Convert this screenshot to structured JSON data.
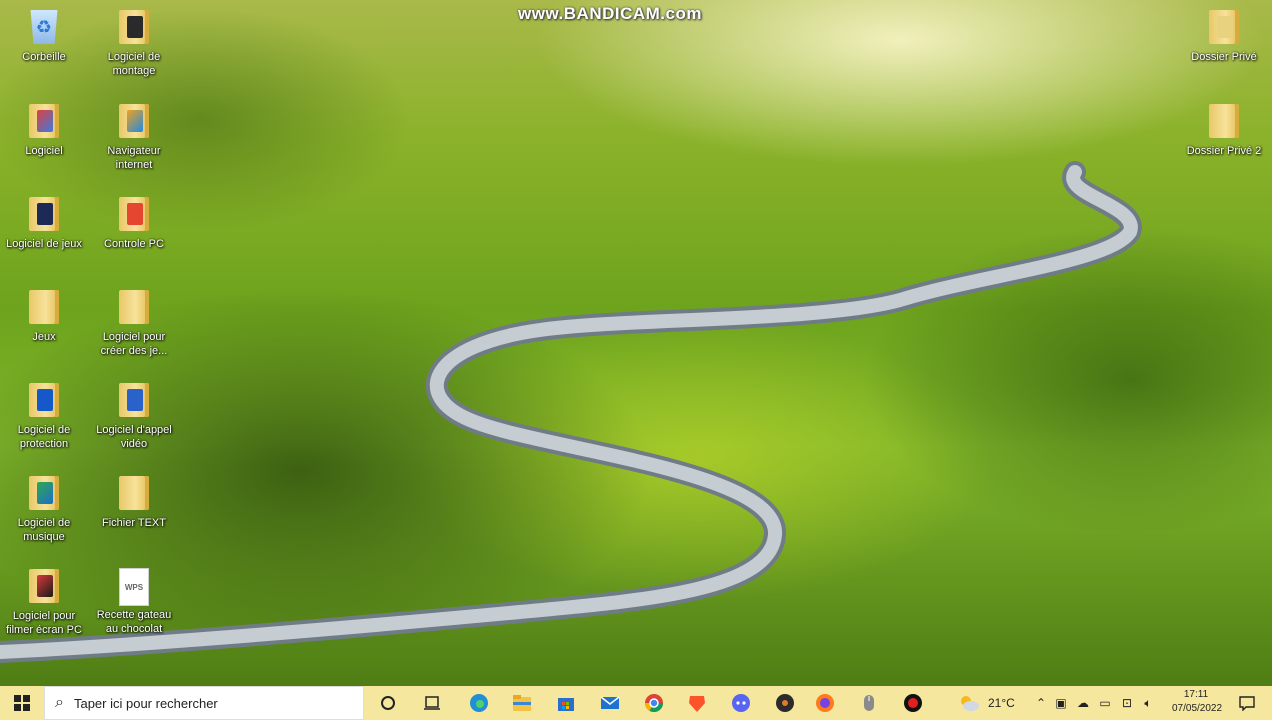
{
  "watermark": "www.BANDICAM.com",
  "desktop": {
    "icons": [
      {
        "label": "Corbeille"
      },
      {
        "label": "Logiciel de montage"
      },
      {
        "label": "Logiciel"
      },
      {
        "label": "Navigateur internet"
      },
      {
        "label": "Logiciel de jeux"
      },
      {
        "label": "Controle PC"
      },
      {
        "label": "Jeux"
      },
      {
        "label": "Logiciel pour créer des je..."
      },
      {
        "label": "Logiciel de protection"
      },
      {
        "label": "Logiciel d'appel vidéo"
      },
      {
        "label": "Logiciel de musique"
      },
      {
        "label": "Fichier TEXT"
      },
      {
        "label": "Logiciel pour filmer écran PC"
      },
      {
        "label": "Recette gateau au chocolat"
      },
      {
        "label": "Dossier Privé"
      },
      {
        "label": "Dossier Privé 2"
      }
    ],
    "wps_text": "WPS"
  },
  "taskbar": {
    "search_placeholder": "Taper ici pour rechercher",
    "weather_temp": "21°C",
    "time": "17:11",
    "date": "07/05/2022"
  },
  "colors": {
    "taskbar": "#f6e79e",
    "accent": "#0078d7"
  }
}
